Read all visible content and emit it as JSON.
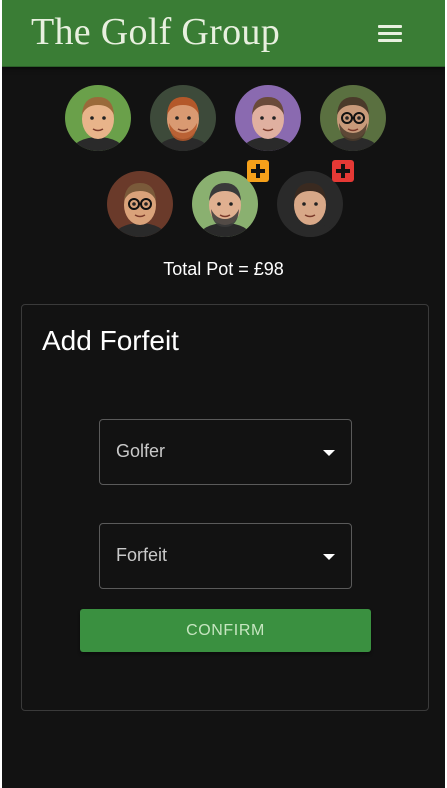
{
  "header": {
    "title": "The Golf Group",
    "menu_icon": "hamburger-menu-icon"
  },
  "golfers": [
    {
      "name": "golfer-1",
      "skin": "#e8b48a",
      "hair": "#9a6a3a",
      "bg": "#6aa04a",
      "beard": false,
      "glasses": false,
      "badge": null
    },
    {
      "name": "golfer-2",
      "skin": "#d99a72",
      "hair": "#b4582a",
      "bg": "#3d4a3a",
      "beard": true,
      "glasses": false,
      "badge": null
    },
    {
      "name": "golfer-3",
      "skin": "#e0b0a0",
      "hair": "#6a4a3a",
      "bg": "#8a6ab0",
      "beard": false,
      "glasses": false,
      "badge": null
    },
    {
      "name": "golfer-4",
      "skin": "#c89a7a",
      "hair": "#4a3a2a",
      "bg": "#5a7040",
      "beard": true,
      "glasses": true,
      "badge": null
    },
    {
      "name": "golfer-5",
      "skin": "#d9a27a",
      "hair": "#7a5a3a",
      "bg": "#6a3a2a",
      "beard": false,
      "glasses": true,
      "badge": null
    },
    {
      "name": "golfer-6",
      "skin": "#e0b090",
      "hair": "#3a3a3a",
      "bg": "#8ab070",
      "beard": true,
      "glasses": false,
      "badge": "orange"
    },
    {
      "name": "golfer-7",
      "skin": "#d8a888",
      "hair": "#3a2a20",
      "bg": "#2a2a2a",
      "beard": false,
      "glasses": false,
      "badge": "red"
    }
  ],
  "badge_colors": {
    "orange": "#f5a01a",
    "red": "#e53935"
  },
  "pot": {
    "text": "Total Pot = £98"
  },
  "form": {
    "title": "Add Forfeit",
    "golfer_select": {
      "placeholder": "Golfer"
    },
    "forfeit_select": {
      "placeholder": "Forfeit"
    },
    "confirm_label": "CONFIRM"
  },
  "colors": {
    "brand_green": "#3a7d35",
    "confirm_green": "#3a9040",
    "background": "#121212"
  }
}
